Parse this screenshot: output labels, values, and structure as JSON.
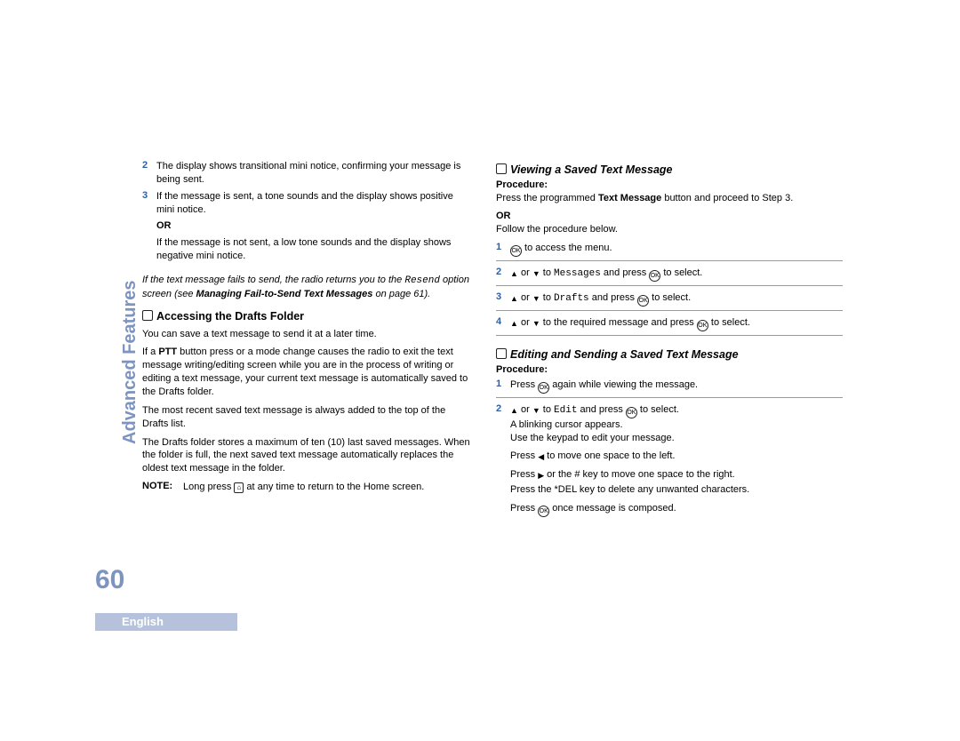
{
  "side_label": "Advanced Features",
  "page_number": "60",
  "language": "English",
  "left": {
    "step2": "The display shows transitional mini notice, confirming your message is being sent.",
    "step3": "If the message is sent, a tone sounds and the display shows positive mini notice.",
    "or": "OR",
    "step_after_or": "If the message is not sent, a low tone sounds and the display shows negative mini notice.",
    "italic1": "If the text message fails to send, the radio returns you to the ",
    "italic_resend": "Resend",
    "italic2": " option screen (see ",
    "italic_bold": "Managing Fail-to-Send Text Messages",
    "italic3": " on page 61).",
    "h3": "Accessing the Drafts Folder",
    "p1": "You can save a text message to send it at a later time.",
    "p2_a": "If a ",
    "p2_ptt": "PTT",
    "p2_b": " button press or a mode change causes the radio to exit the text message writing/editing screen while you are in the process of writing or editing a text message, your current text message is automatically saved to the Drafts folder.",
    "p3": "The most recent saved text message is always added to the top of the Drafts list.",
    "p4": "The Drafts folder stores a maximum of ten (10) last saved messages. When the folder is full, the next saved text message automatically replaces the oldest text message in the folder.",
    "note_label": "NOTE:",
    "note_a": "Long press ",
    "note_b": " at any time to return to the Home screen."
  },
  "right": {
    "h3a": "Viewing a Saved Text Message",
    "proc": "Procedure:",
    "proc_a1": "Press the programmed ",
    "proc_a_bold": "Text Message",
    "proc_a2": " button and proceed to Step 3.",
    "or": "OR",
    "proc_b": "Follow the procedure below.",
    "s1": " to access the menu.",
    "s2a": " or ",
    "s2b": " to ",
    "s2_msg": "Messages",
    "s2c": " and press ",
    "s2d": " to select.",
    "s3_drafts": "Drafts",
    "s4": " to the required message and press ",
    "h3b": "Editing and Sending a Saved Text Message",
    "e1a": "Press ",
    "e1b": " again while viewing the message.",
    "e2_edit": "Edit",
    "e_blink": "A blinking cursor appears.",
    "e_keypad": "Use the keypad to edit your message.",
    "e_left": " to move one space to the left.",
    "e_right": " or the # key to move one space to the right.",
    "e_del": "Press the *DEL key to delete any unwanted characters.",
    "e_done": " once message is composed."
  }
}
